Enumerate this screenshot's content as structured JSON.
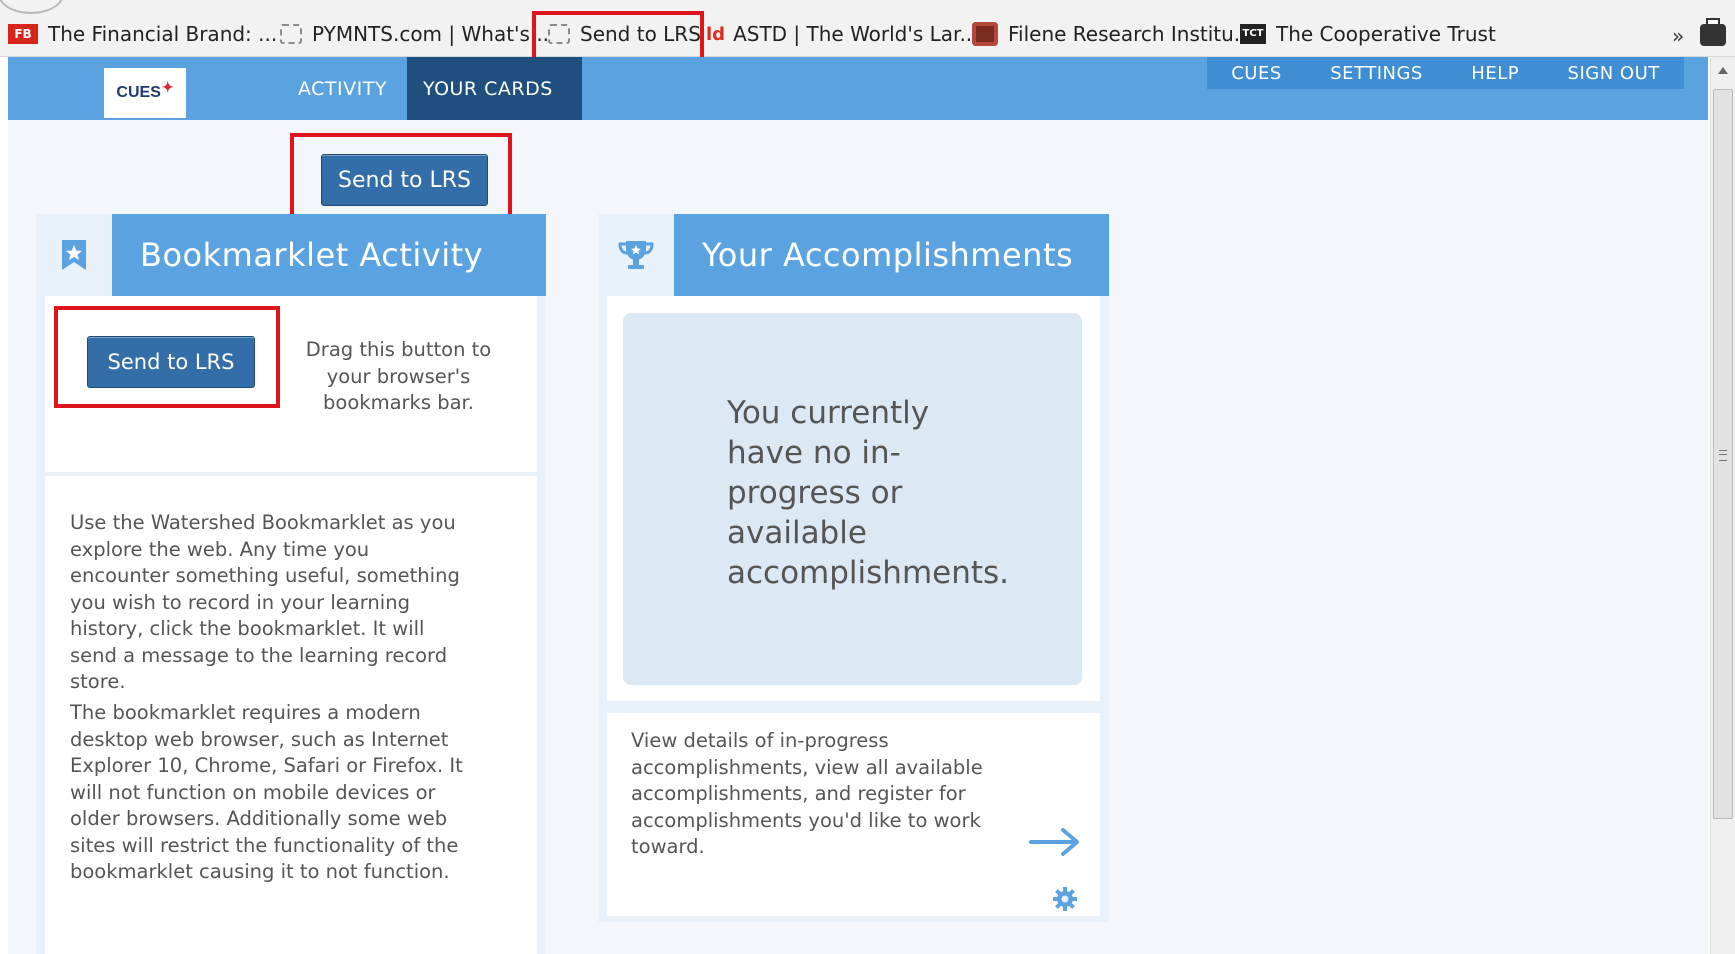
{
  "bookmarks": [
    {
      "label": "The Financial Brand: ...",
      "icon": "financial-brand-icon",
      "icon_text": "FB"
    },
    {
      "label": "PYMNTS.com | What's...",
      "icon": "page-icon"
    },
    {
      "label": "Send to LRS",
      "icon": "page-icon"
    },
    {
      "label": "ASTD | The World's Lar...",
      "icon": "astd-icon",
      "icon_text": "ld"
    },
    {
      "label": "Filene Research Institu...",
      "icon": "filene-icon"
    },
    {
      "label": "The Cooperative Trust",
      "icon": "tct-icon",
      "icon_text": "TCT"
    }
  ],
  "bookmarks_overflow": "»",
  "app": {
    "logo": "CUES",
    "tabs": [
      {
        "label": "ACTIVITY",
        "active": false
      },
      {
        "label": "YOUR CARDS",
        "active": true
      }
    ],
    "right_links": [
      "CUES",
      "SETTINGS",
      "HELP",
      "SIGN OUT"
    ]
  },
  "send_button_top": "Send to LRS",
  "bookmarklet_card": {
    "title": "Bookmarklet Activity",
    "icon": "bookmark-star-icon",
    "button": "Send to LRS",
    "drag_hint": "Drag this button to your browser's bookmarks bar.",
    "paragraph1": "Use the Watershed Bookmarklet as you explore the web. Any time you encounter something useful, something you wish to record in your learning history, click the bookmarklet. It will send a message to the learning record store.",
    "paragraph2": "The bookmarklet requires a modern desktop web browser, such as Internet Explorer 10, Chrome, Safari or Firefox. It will not function on mobile devices or older browsers. Additionally some web sites will restrict the functionality of the bookmarklet causing it to not function."
  },
  "accomplishments_card": {
    "title": "Your Accomplishments",
    "icon": "trophy-icon",
    "empty_message": "You currently have no in-progress or available accomplishments.",
    "description": "View details of in-progress accomplishments, view all available accomplishments, and register for accomplishments you'd like to work toward.",
    "link_icon": "arrow-right-icon",
    "settings_icon": "gear-icon"
  },
  "colors": {
    "nav_blue": "#5ba3e0",
    "nav_active": "#1f4f7d",
    "button_blue": "#336ea8",
    "highlight_red": "#e0141b"
  }
}
